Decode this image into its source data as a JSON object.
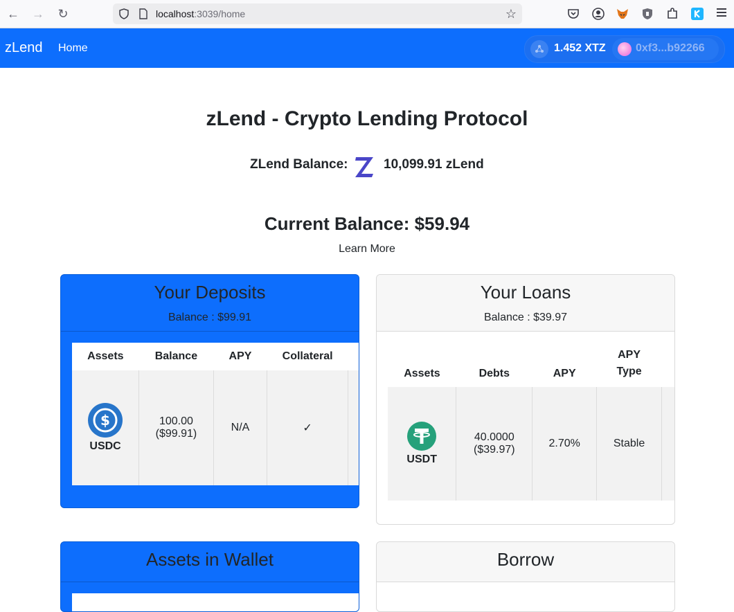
{
  "browser": {
    "url_host": "localhost",
    "url_rest": ":3039/home"
  },
  "navbar": {
    "brand": "zLend",
    "home": "Home",
    "xtz_balance": "1.452 XTZ",
    "address": "0xf3...b92266"
  },
  "main": {
    "title": "zLend - Crypto Lending Protocol",
    "zlend_label": "ZLend Balance:",
    "zlend_value": "10,099.91 zLend",
    "current_balance": "Current Balance: $59.94",
    "learn_more": "Learn More"
  },
  "deposits": {
    "title": "Your Deposits",
    "balance": "Balance : $99.91",
    "headers": [
      "Assets",
      "Balance",
      "APY",
      "Collateral"
    ],
    "row": {
      "asset": "USDC",
      "balance_line1": "100.00",
      "balance_line2": "($99.91)",
      "apy": "N/A",
      "collateral": "✓"
    }
  },
  "loans": {
    "title": "Your Loans",
    "balance": "Balance : $39.97",
    "headers": [
      "Assets",
      "Debts",
      "APY",
      "APY",
      "Type"
    ],
    "row": {
      "asset": "USDT",
      "debt_line1": "40.0000",
      "debt_line2": "($39.97)",
      "apy": "2.70%",
      "type": "Stable"
    }
  },
  "wallet_assets": {
    "title": "Assets in Wallet"
  },
  "borrow": {
    "title": "Borrow"
  },
  "colors": {
    "primary": "#0d6efd",
    "usdc": "#2775ca",
    "usdt": "#26a17b",
    "zlend_logo": "#4a46c8"
  }
}
